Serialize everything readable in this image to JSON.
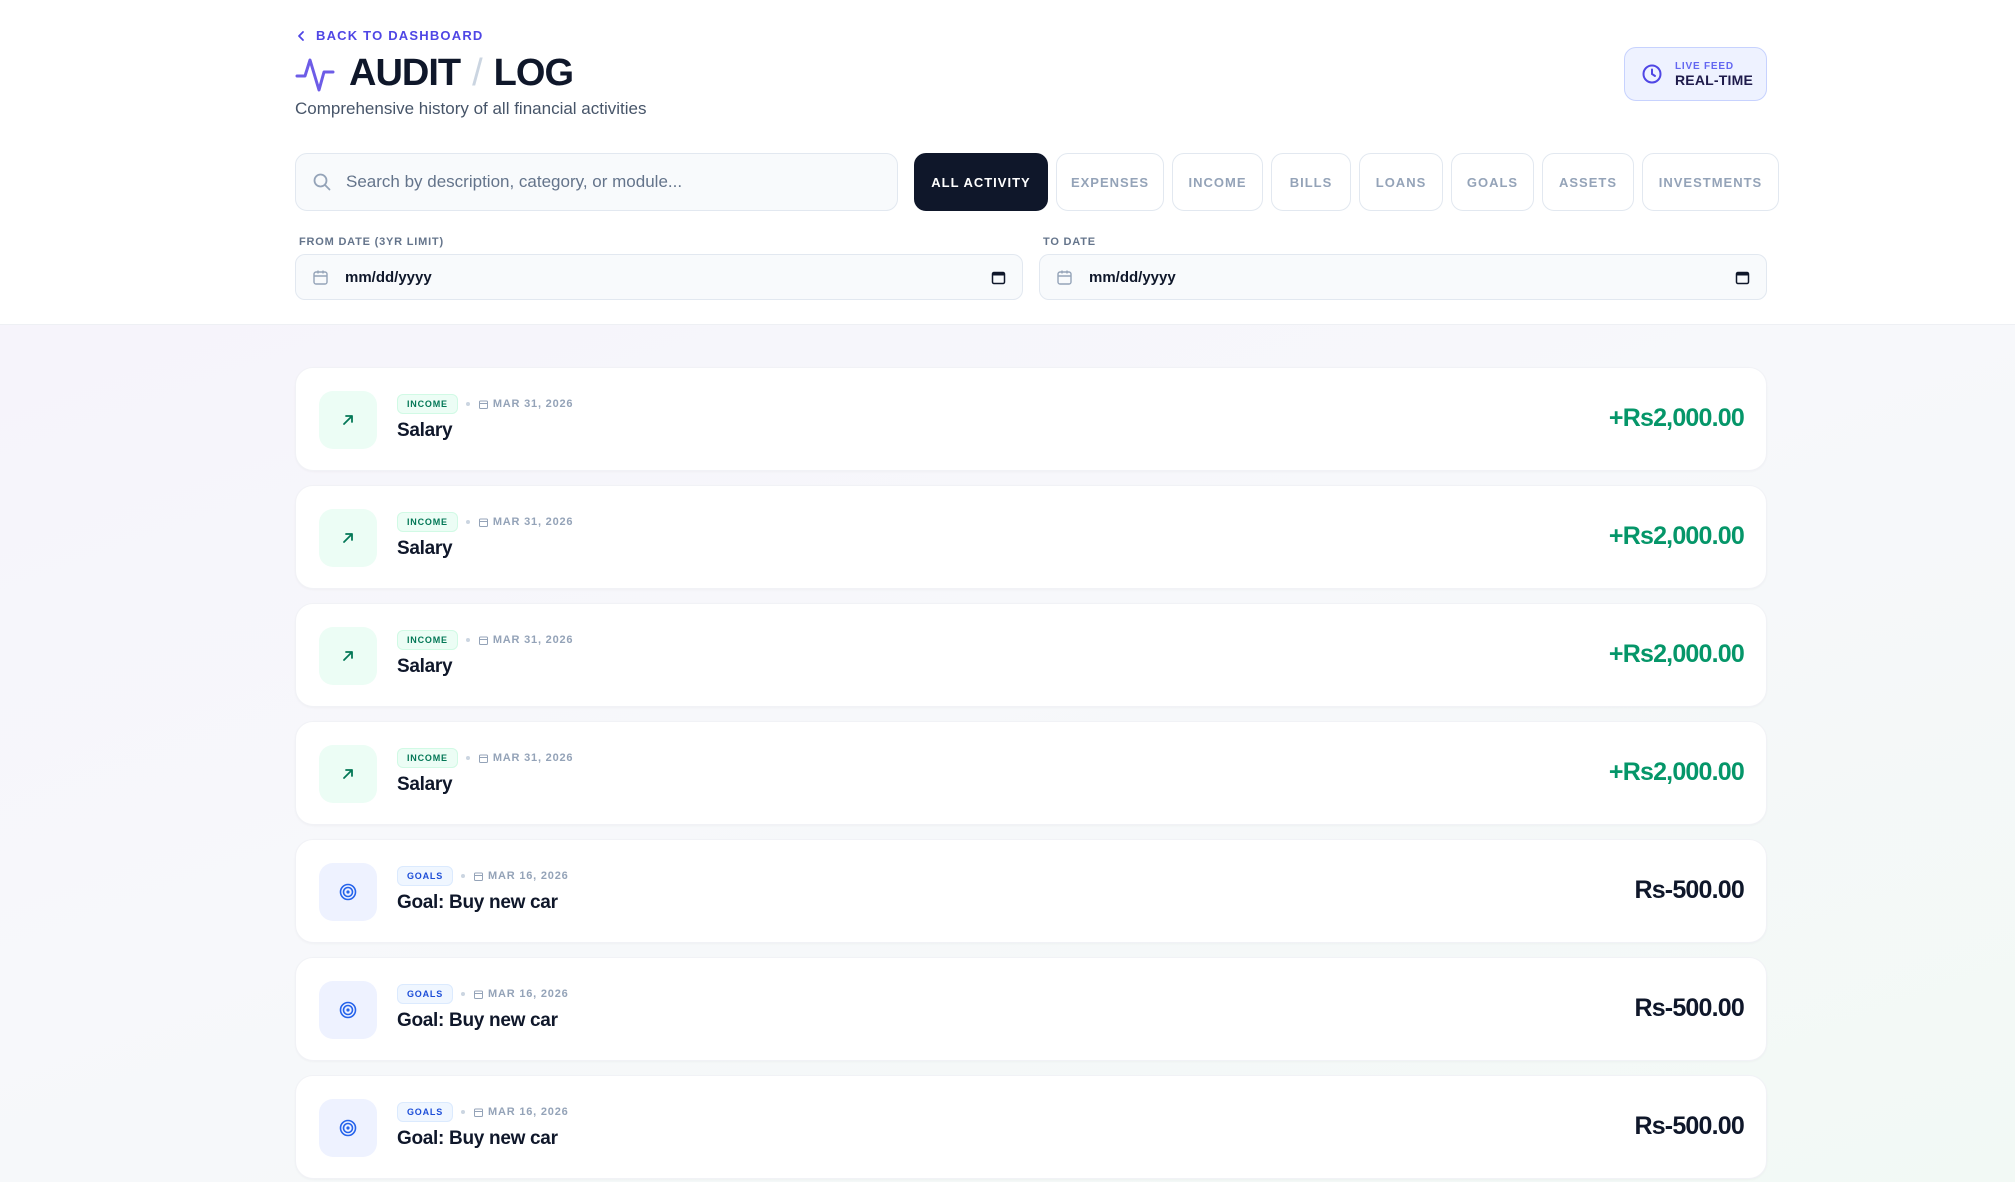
{
  "header": {
    "back_label": "BACK TO DASHBOARD",
    "title_part1": "AUDIT",
    "title_sep": "/",
    "title_part2": "LOG",
    "subtitle": "Comprehensive history of all financial activities",
    "live_badge": {
      "top": "LIVE FEED",
      "main": "REAL-TIME"
    }
  },
  "search": {
    "placeholder": "Search by description, category, or module...",
    "value": ""
  },
  "filters": {
    "active": "ALL ACTIVITY",
    "items": [
      "ALL ACTIVITY",
      "EXPENSES",
      "INCOME",
      "BILLS",
      "LOANS",
      "GOALS",
      "ASSETS",
      "INVESTMENTS"
    ]
  },
  "date_range": {
    "from_label": "FROM DATE (3YR LIMIT)",
    "from_value": "mm/dd/yyyy",
    "to_label": "TO DATE",
    "to_value": "mm/dd/yyyy"
  },
  "colors": {
    "accent": "#4f46e5",
    "income_green": "#059669",
    "goals_blue": "#1d4ed8",
    "active_chip": "#0f172a"
  },
  "entries": [
    {
      "module": "INCOME",
      "icon": "arrow-up-right-icon",
      "date": "MAR 31, 2026",
      "description": "Salary",
      "amount": "+Rs2,000.00"
    },
    {
      "module": "INCOME",
      "icon": "arrow-up-right-icon",
      "date": "MAR 31, 2026",
      "description": "Salary",
      "amount": "+Rs2,000.00"
    },
    {
      "module": "INCOME",
      "icon": "arrow-up-right-icon",
      "date": "MAR 31, 2026",
      "description": "Salary",
      "amount": "+Rs2,000.00"
    },
    {
      "module": "INCOME",
      "icon": "arrow-up-right-icon",
      "date": "MAR 31, 2026",
      "description": "Salary",
      "amount": "+Rs2,000.00"
    },
    {
      "module": "GOALS",
      "icon": "target-icon",
      "date": "MAR 16, 2026",
      "description": "Goal: Buy new car",
      "amount": "Rs-500.00"
    },
    {
      "module": "GOALS",
      "icon": "target-icon",
      "date": "MAR 16, 2026",
      "description": "Goal: Buy new car",
      "amount": "Rs-500.00"
    },
    {
      "module": "GOALS",
      "icon": "target-icon",
      "date": "MAR 16, 2026",
      "description": "Goal: Buy new car",
      "amount": "Rs-500.00"
    }
  ]
}
